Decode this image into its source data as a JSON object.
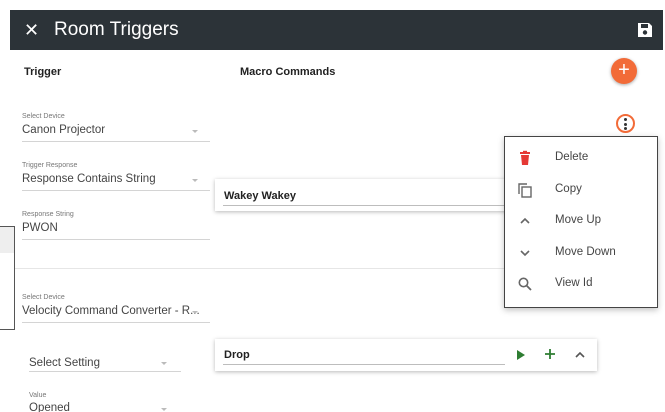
{
  "header": {
    "title": "Room Triggers",
    "close_icon": "close-icon",
    "save_icon": "save-icon"
  },
  "columns": {
    "trigger": "Trigger",
    "macro": "Macro Commands"
  },
  "trigger1": {
    "device_label": "Select Device",
    "device_value": "Canon Projector",
    "response_label": "Trigger Response",
    "response_value": "Response Contains String",
    "string_label": "Response String",
    "string_value": "PWON"
  },
  "trigger2": {
    "device_label": "Select Device",
    "device_value": "Velocity Command Converter - R...",
    "setting_value": "Select Setting",
    "value_label": "Value",
    "value_value": "Opened"
  },
  "macros": {
    "first_name": "Wakey Wakey",
    "second_name": "Drop"
  },
  "menu": {
    "items": [
      {
        "label": "Delete",
        "icon": "trash-icon"
      },
      {
        "label": "Copy",
        "icon": "copy-icon"
      },
      {
        "label": "Move Up",
        "icon": "chevron-up-icon"
      },
      {
        "label": "Move Down",
        "icon": "chevron-down-icon"
      },
      {
        "label": "View Id",
        "icon": "search-icon"
      }
    ]
  },
  "colors": {
    "header_bg": "#2c3338",
    "accent": "#f26b38",
    "delete_red": "#e53935",
    "play_green": "#2e7d32"
  }
}
